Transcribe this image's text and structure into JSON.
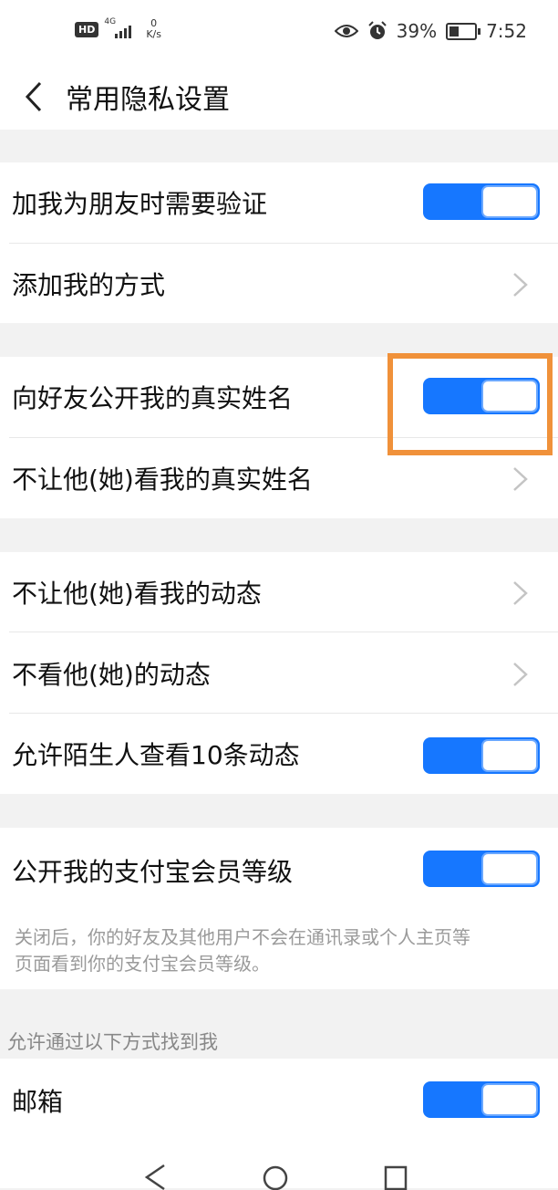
{
  "status_bar": {
    "hd_badge": "HD",
    "network": "4G",
    "speed_value": "0",
    "speed_unit": "K/s",
    "battery_percent": "39%",
    "battery_level": 0.39,
    "time": "7:52"
  },
  "header": {
    "title": "常用隐私设置"
  },
  "groups": [
    {
      "items": [
        {
          "label": "加我为朋友时需要验证",
          "control": "toggle",
          "on": true
        },
        {
          "label": "添加我的方式",
          "control": "chevron"
        }
      ]
    },
    {
      "items": [
        {
          "label": "向好友公开我的真实姓名",
          "control": "toggle",
          "on": true
        },
        {
          "label": "不让他(她)看我的真实姓名",
          "control": "chevron"
        }
      ]
    },
    {
      "items": [
        {
          "label": "不让他(她)看我的动态",
          "control": "chevron"
        },
        {
          "label": "不看他(她)的动态",
          "control": "chevron"
        },
        {
          "label": "允许陌生人查看10条动态",
          "control": "toggle",
          "on": true
        }
      ]
    },
    {
      "items": [
        {
          "label": "公开我的支付宝会员等级",
          "control": "toggle",
          "on": true
        }
      ],
      "note_line1": "关闭后，你的好友及其他用户不会在通讯录或个人主页等",
      "note_line2": "页面看到你的支付宝会员等级。"
    }
  ],
  "section_find_me": {
    "label": "允许通过以下方式找到我",
    "items": [
      {
        "label": "邮箱",
        "control": "toggle",
        "on": true
      }
    ]
  },
  "colors": {
    "accent": "#1677ff",
    "highlight": "#f0913a"
  }
}
